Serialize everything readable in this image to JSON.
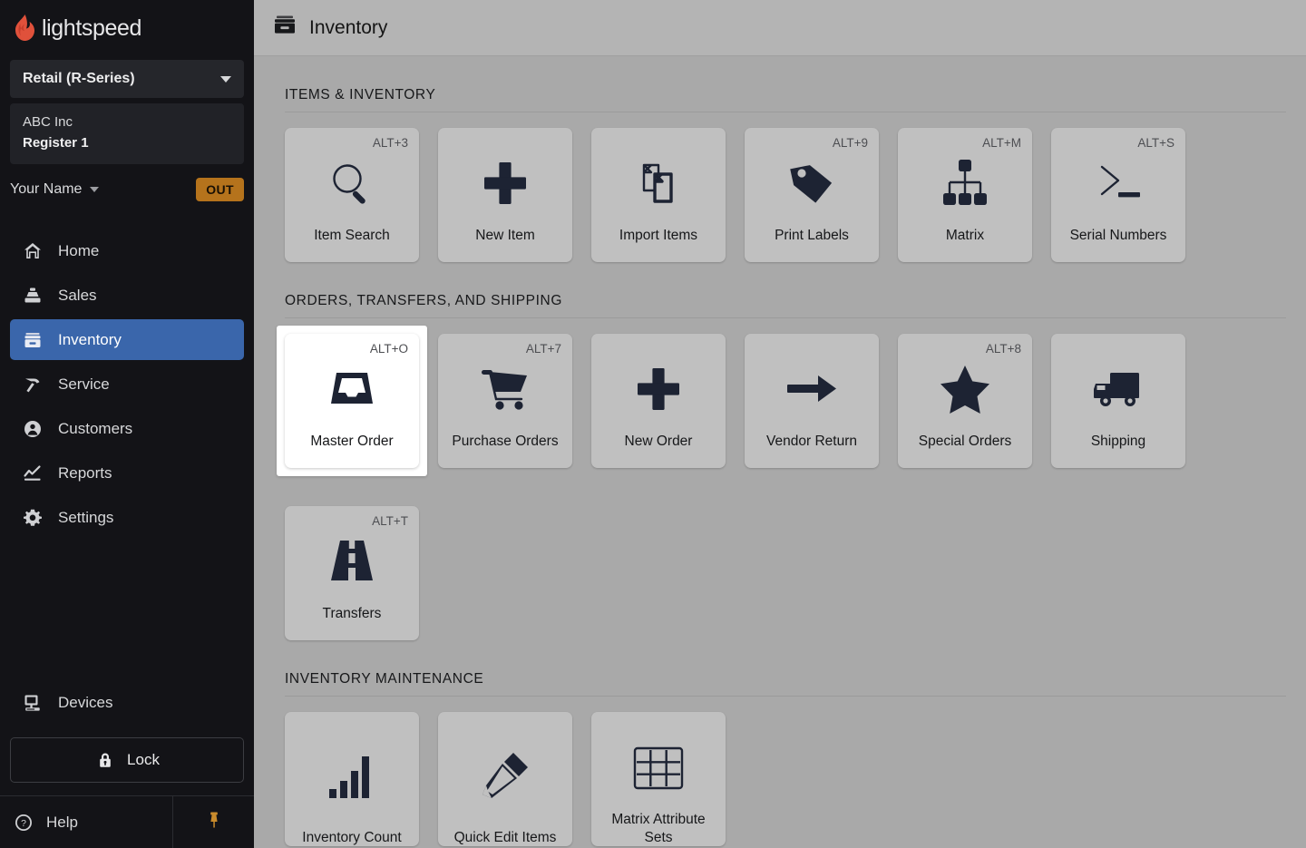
{
  "brand": {
    "name": "lightspeed",
    "logo_icon": "lightspeed-flame-icon",
    "accent": "#e0513b"
  },
  "sidebar": {
    "product_selector": {
      "label": "Retail (R-Series)",
      "icon": "chevron-down-icon"
    },
    "register": {
      "company": "ABC Inc",
      "register": "Register 1"
    },
    "user": {
      "name": "Your Name",
      "caret_icon": "chevron-down-icon",
      "status_badge": "OUT",
      "badge_color": "#b5731c"
    },
    "nav_items": [
      {
        "label": "Home",
        "icon": "home-icon",
        "active": false
      },
      {
        "label": "Sales",
        "icon": "sales-register-icon",
        "active": false
      },
      {
        "label": "Inventory",
        "icon": "inventory-box-icon",
        "active": true
      },
      {
        "label": "Service",
        "icon": "hammer-icon",
        "active": false
      },
      {
        "label": "Customers",
        "icon": "person-circle-icon",
        "active": false
      },
      {
        "label": "Reports",
        "icon": "line-chart-icon",
        "active": false
      },
      {
        "label": "Settings",
        "icon": "gear-icon",
        "active": false
      }
    ],
    "devices": {
      "label": "Devices",
      "icon": "monitor-icon"
    },
    "lock": {
      "label": "Lock",
      "icon": "lock-icon"
    },
    "help": {
      "label": "Help",
      "icon": "question-circle-icon"
    },
    "pin": {
      "icon": "pushpin-icon",
      "color": "#c98b2c"
    },
    "active_color": "#3a66ab"
  },
  "header": {
    "title": "Inventory",
    "icon": "inventory-box-icon"
  },
  "sections": [
    {
      "title": "ITEMS & INVENTORY",
      "tiles": [
        {
          "label": "Item Search",
          "shortcut": "ALT+3",
          "icon": "magnifier-icon",
          "highlighted": false
        },
        {
          "label": "New Item",
          "shortcut": "",
          "icon": "plus-icon",
          "highlighted": false
        },
        {
          "label": "Import Items",
          "shortcut": "",
          "icon": "copy-documents-icon",
          "highlighted": false
        },
        {
          "label": "Print Labels",
          "shortcut": "ALT+9",
          "icon": "price-tag-icon",
          "highlighted": false
        },
        {
          "label": "Matrix",
          "shortcut": "ALT+M",
          "icon": "hierarchy-icon",
          "highlighted": false
        },
        {
          "label": "Serial Numbers",
          "shortcut": "ALT+S",
          "icon": "terminal-icon",
          "highlighted": false
        }
      ]
    },
    {
      "title": "ORDERS, TRANSFERS, AND SHIPPING",
      "tiles": [
        {
          "label": "Master Order",
          "shortcut": "ALT+O",
          "icon": "inbox-tray-icon",
          "highlighted": true
        },
        {
          "label": "Purchase Orders",
          "shortcut": "ALT+7",
          "icon": "shopping-cart-icon",
          "highlighted": false
        },
        {
          "label": "New Order",
          "shortcut": "",
          "icon": "plus-icon",
          "highlighted": false
        },
        {
          "label": "Vendor Return",
          "shortcut": "",
          "icon": "arrow-right-icon",
          "highlighted": false
        },
        {
          "label": "Special Orders",
          "shortcut": "ALT+8",
          "icon": "star-icon",
          "highlighted": false
        },
        {
          "label": "Shipping",
          "shortcut": "",
          "icon": "delivery-truck-icon",
          "highlighted": false
        },
        {
          "label": "Transfers",
          "shortcut": "ALT+T",
          "icon": "road-icon",
          "highlighted": false
        }
      ]
    },
    {
      "title": "INVENTORY MAINTENANCE",
      "tiles": [
        {
          "label": "Inventory Count",
          "shortcut": "",
          "icon": "bar-chart-icon",
          "highlighted": false
        },
        {
          "label": "Quick Edit Items",
          "shortcut": "",
          "icon": "pencil-icon",
          "highlighted": false
        },
        {
          "label": "Matrix Attribute Sets",
          "shortcut": "",
          "icon": "grid-table-icon",
          "highlighted": false
        }
      ]
    }
  ]
}
